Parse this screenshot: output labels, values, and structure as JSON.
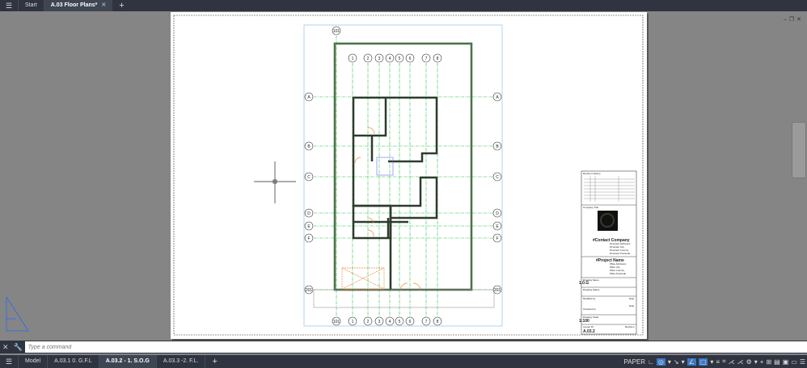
{
  "tabs": {
    "start": "Start",
    "active": "A.03 Floor Plans*"
  },
  "window_controls": {
    "min": "–",
    "restore": "❐",
    "close": "✕"
  },
  "command": {
    "placeholder": "Type a command"
  },
  "layouts": [
    "Model",
    "A.03.1 0. G.F.L",
    "A.03.2 - 1. S.O.G",
    "A.03.3 -2. F.L."
  ],
  "status": {
    "paper": "PAPER"
  },
  "grid": {
    "columns": [
      "1",
      "2",
      "3",
      "4",
      "5",
      "6",
      "7",
      "8"
    ],
    "rows": [
      "A",
      "B",
      "C",
      "D",
      "E",
      "F"
    ],
    "top_bubble": "101",
    "bottom_bubble": "201"
  },
  "title_block": {
    "revision_history": "Revision History",
    "company_title": "Company Title",
    "company": "#Contact Company",
    "company_lines": [
      "#Contact Address1",
      "#Contact City",
      "#Contact Country",
      "#Contact Postcode"
    ],
    "project": "#Project Name",
    "project_lines": [
      "#Site Address1",
      "#Site City",
      "#Site Country",
      "#Site Postcode"
    ],
    "drawing_name_label": "Drawing Name",
    "drawing_name": "1.0.G",
    "drawing_status": "Drawing Status",
    "modified_by": "Modified by",
    "checked_by": "Checked by",
    "date": "Date",
    "drawing_scale_label": "Drawing Scale",
    "scale": "1:100",
    "layout_id_label": "Layout ID",
    "revision": "Revision",
    "layout_id": "A.03.2"
  }
}
